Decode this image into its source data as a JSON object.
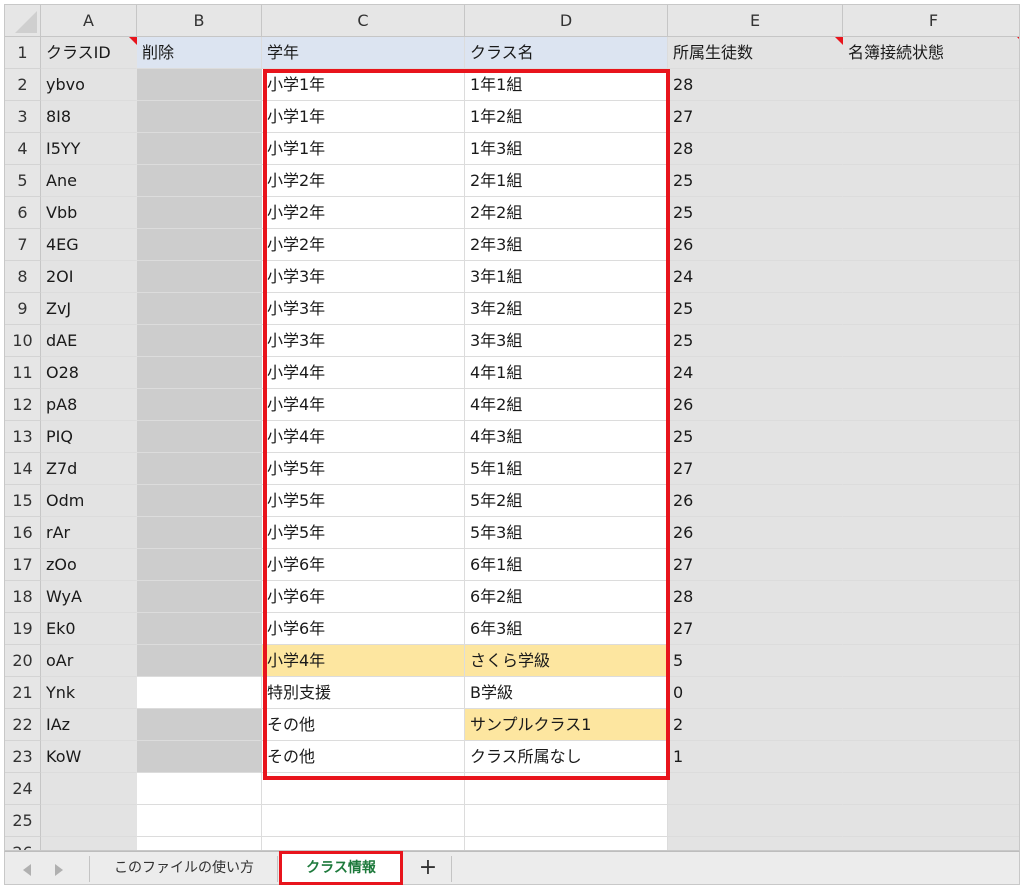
{
  "columns": [
    "A",
    "B",
    "C",
    "D",
    "E",
    "F"
  ],
  "header_row": {
    "row_number": "1",
    "cells": [
      "クラスID",
      "削除",
      "学年",
      "クラス名",
      "所属生徒数",
      "名簿接続状態"
    ]
  },
  "rows": [
    {
      "n": "2",
      "id": "ybvo",
      "grade": "小学1年",
      "cls": "1年1組",
      "count": "28"
    },
    {
      "n": "3",
      "id": "8I8",
      "grade": "小学1年",
      "cls": "1年2組",
      "count": "27"
    },
    {
      "n": "4",
      "id": "I5YY",
      "grade": "小学1年",
      "cls": "1年3組",
      "count": "28"
    },
    {
      "n": "5",
      "id": "Ane",
      "grade": "小学2年",
      "cls": "2年1組",
      "count": "25"
    },
    {
      "n": "6",
      "id": "Vbb",
      "grade": "小学2年",
      "cls": "2年2組",
      "count": "25"
    },
    {
      "n": "7",
      "id": "4EG",
      "grade": "小学2年",
      "cls": "2年3組",
      "count": "26"
    },
    {
      "n": "8",
      "id": "2OI",
      "grade": "小学3年",
      "cls": "3年1組",
      "count": "24"
    },
    {
      "n": "9",
      "id": "ZvJ",
      "grade": "小学3年",
      "cls": "3年2組",
      "count": "25"
    },
    {
      "n": "10",
      "id": "dAE",
      "grade": "小学3年",
      "cls": "3年3組",
      "count": "25"
    },
    {
      "n": "11",
      "id": "O28",
      "grade": "小学4年",
      "cls": "4年1組",
      "count": "24"
    },
    {
      "n": "12",
      "id": "pA8",
      "grade": "小学4年",
      "cls": "4年2組",
      "count": "26"
    },
    {
      "n": "13",
      "id": "PIQ",
      "grade": "小学4年",
      "cls": "4年3組",
      "count": "25"
    },
    {
      "n": "14",
      "id": "Z7d",
      "grade": "小学5年",
      "cls": "5年1組",
      "count": "27"
    },
    {
      "n": "15",
      "id": "Odm",
      "grade": "小学5年",
      "cls": "5年2組",
      "count": "26"
    },
    {
      "n": "16",
      "id": "rAr",
      "grade": "小学5年",
      "cls": "5年3組",
      "count": "26"
    },
    {
      "n": "17",
      "id": "zOo",
      "grade": "小学6年",
      "cls": "6年1組",
      "count": "27"
    },
    {
      "n": "18",
      "id": "WyA",
      "grade": "小学6年",
      "cls": "6年2組",
      "count": "28"
    },
    {
      "n": "19",
      "id": "Ek0",
      "grade": "小学6年",
      "cls": "6年3組",
      "count": "27"
    },
    {
      "n": "20",
      "id": "oAr",
      "grade": "小学4年",
      "cls": "さくら学級",
      "count": "5"
    },
    {
      "n": "21",
      "id": "Ynk",
      "grade": "特別支援",
      "cls": "B学級",
      "count": "0"
    },
    {
      "n": "22",
      "id": "IAz",
      "grade": "その他",
      "cls": "サンプルクラス1",
      "count": "2"
    },
    {
      "n": "23",
      "id": "KoW",
      "grade": "その他",
      "cls": "クラス所属なし",
      "count": "1"
    }
  ],
  "empty_rows": [
    "24",
    "25",
    "26"
  ],
  "tabs": {
    "usage": "このファイルの使い方",
    "class_info": "クラス情報",
    "add": "+"
  },
  "colors": {
    "highlight": "#e8141c",
    "header_fill": "#dce4f1",
    "yellow_fill": "#fde6a0",
    "active_tab_text": "#1e7a3c"
  }
}
